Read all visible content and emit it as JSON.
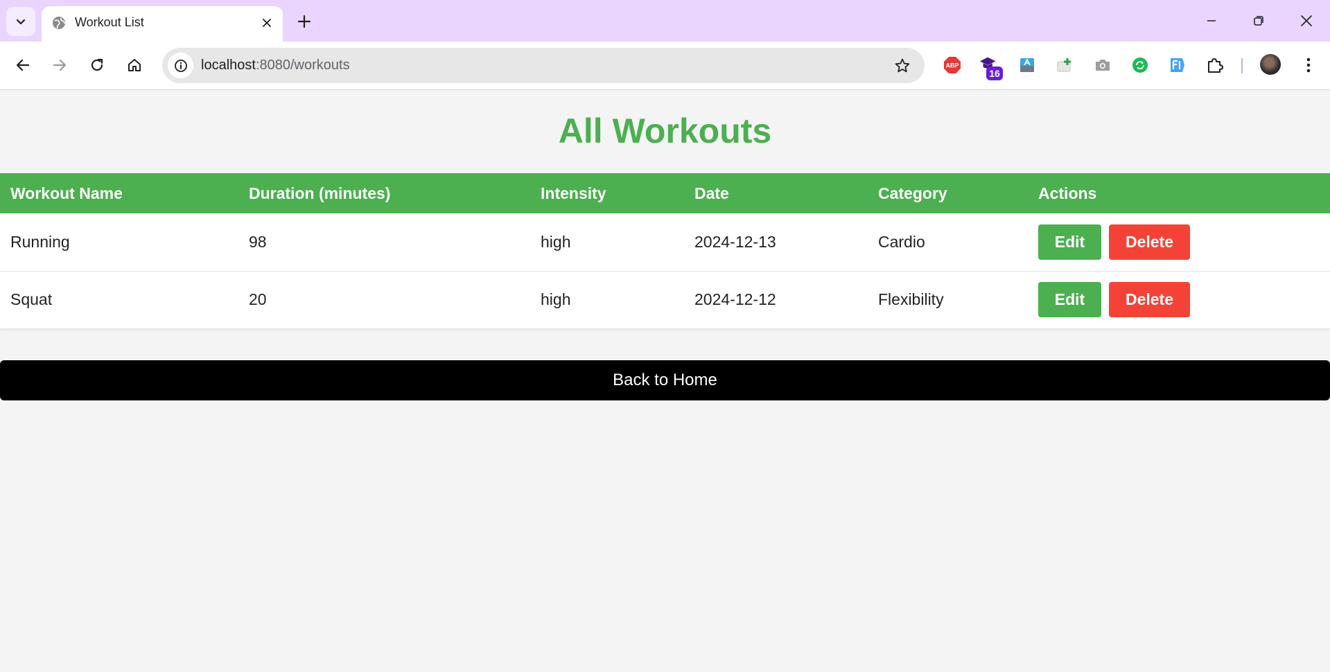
{
  "browser": {
    "tab": {
      "title": "Workout List"
    },
    "address_bar": {
      "host": "localhost",
      "path": ":8080/workouts"
    },
    "extensions": {
      "abp_label": "ABP",
      "badge_count": "16"
    }
  },
  "page": {
    "title": "All Workouts",
    "table": {
      "headers": [
        "Workout Name",
        "Duration (minutes)",
        "Intensity",
        "Date",
        "Category",
        "Actions"
      ],
      "rows": [
        {
          "name": "Running",
          "duration": "98",
          "intensity": "high",
          "date": "2024-12-13",
          "category": "Cardio"
        },
        {
          "name": "Squat",
          "duration": "20",
          "intensity": "high",
          "date": "2024-12-12",
          "category": "Flexibility"
        }
      ],
      "edit_label": "Edit",
      "delete_label": "Delete"
    },
    "home_button_label": "Back to Home"
  },
  "colors": {
    "accent": "#4caf50",
    "danger": "#f44336",
    "tabbar": "#e9d5ff",
    "home_button": "#000000"
  }
}
